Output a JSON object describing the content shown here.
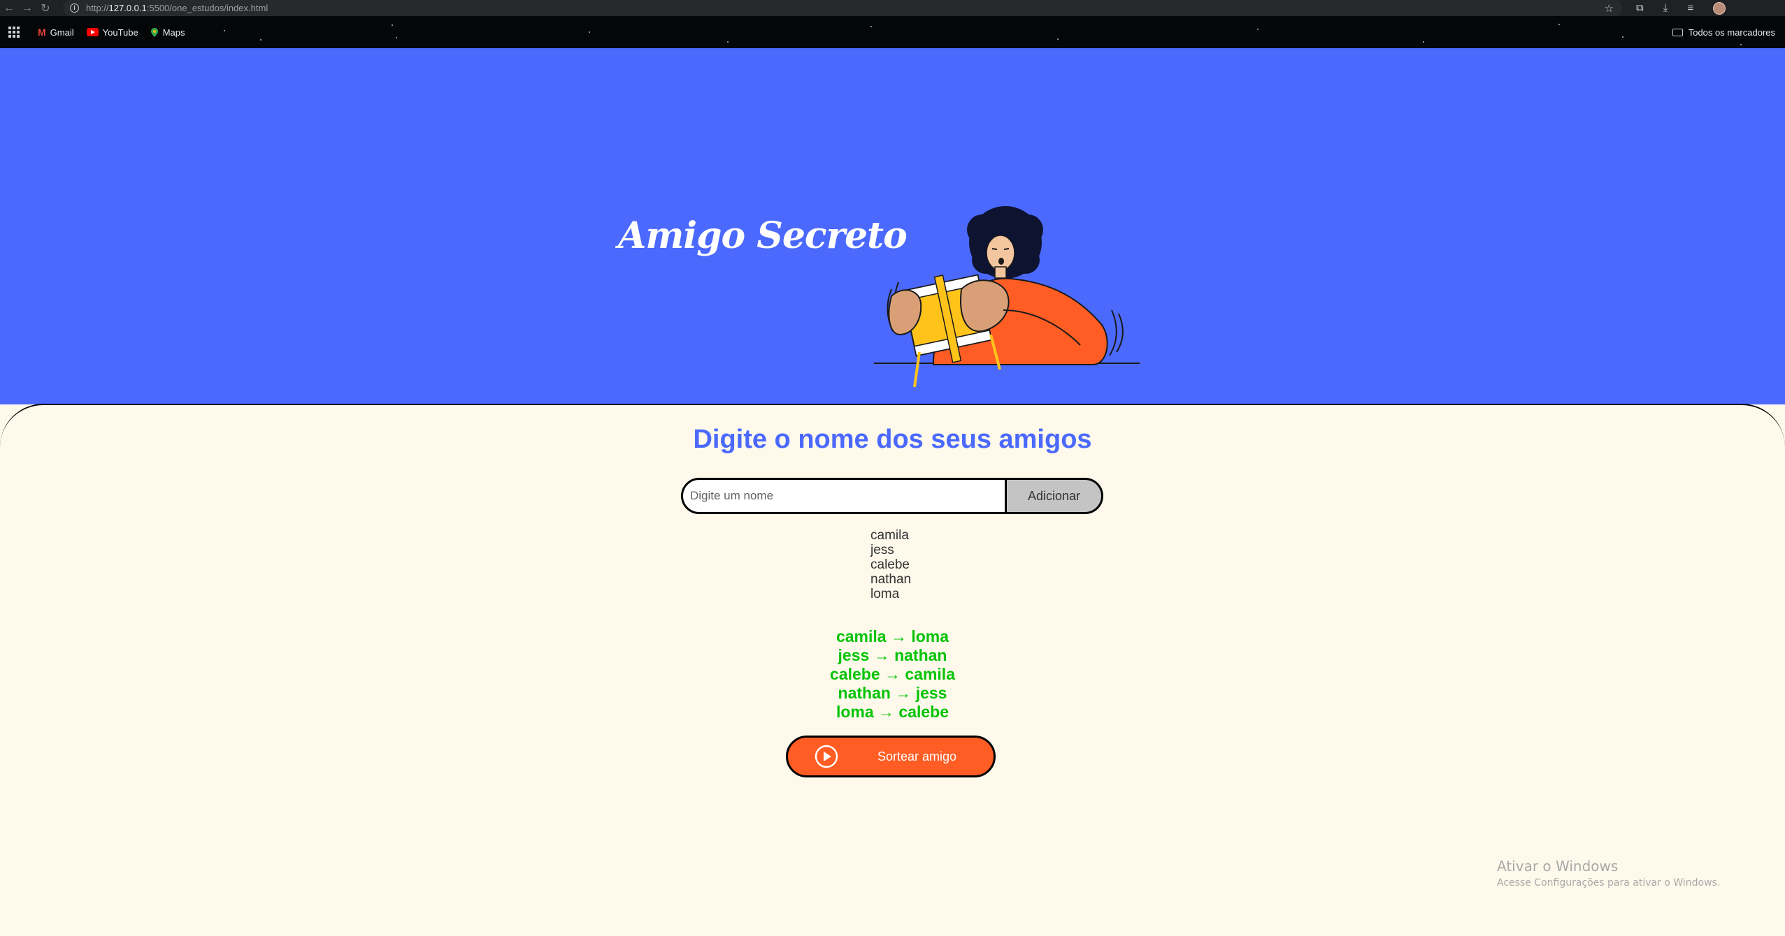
{
  "browser": {
    "url_prefix": "http://",
    "url_host": "127.0.0.1",
    "url_path": ":5500/one_estudos/index.html",
    "bookmarks": [
      {
        "label": "Gmail",
        "icon": "gmail-icon"
      },
      {
        "label": "YouTube",
        "icon": "youtube-icon"
      },
      {
        "label": "Maps",
        "icon": "maps-icon"
      }
    ],
    "all_bookmarks_label": "Todos os marcadores"
  },
  "header": {
    "title": "Amigo Secreto",
    "illustration": "person-holding-gift-box-illustration"
  },
  "main": {
    "section_title": "Digite o nome dos seus amigos",
    "input_placeholder": "Digite um nome",
    "add_button_label": "Adicionar",
    "friends": [
      "camila",
      "jess",
      "calebe",
      "nathan",
      "loma"
    ],
    "results": [
      "camila → loma",
      "jess → nathan",
      "calebe → camila",
      "nathan → jess",
      "loma → calebe"
    ],
    "draw_button_label": "Sortear amigo",
    "draw_button_icon": "play-icon"
  },
  "windows_activation": {
    "title": "Ativar o Windows",
    "subtitle": "Acesse Configurações para ativar o Windows."
  },
  "colors": {
    "hero_bg": "#4b69fd",
    "main_bg": "#fff9eb",
    "accent_blue": "#4b69fd",
    "result_green": "#05c305",
    "button_orange": "#ff5d24"
  }
}
